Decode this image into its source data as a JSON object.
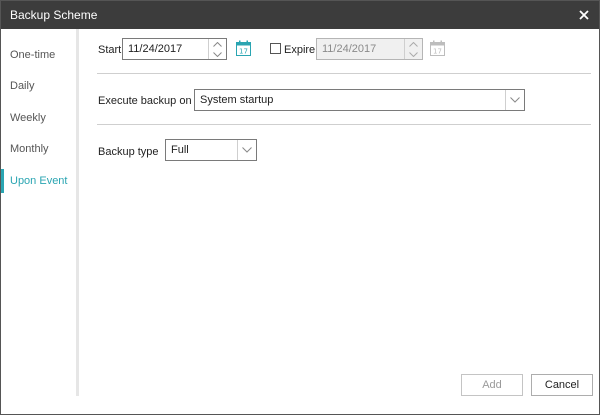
{
  "window": {
    "title": "Backup Scheme"
  },
  "sidebar": {
    "items": [
      {
        "label": "One-time"
      },
      {
        "label": "Daily"
      },
      {
        "label": "Weekly"
      },
      {
        "label": "Monthly"
      },
      {
        "label": "Upon Event",
        "active": true
      }
    ]
  },
  "schedule": {
    "start_label": "Start",
    "start_date": "11/24/2017",
    "expire_label": "Expire",
    "expire_checked": false,
    "expire_date": "11/24/2017",
    "calendar_day": "17"
  },
  "event": {
    "execute_label": "Execute backup on",
    "execute_value": "System startup"
  },
  "backup_type": {
    "label": "Backup type",
    "value": "Full"
  },
  "footer": {
    "add_label": "Add",
    "cancel_label": "Cancel"
  },
  "colors": {
    "accent": "#2aa5b2",
    "titlebar": "#3c3c3c"
  }
}
